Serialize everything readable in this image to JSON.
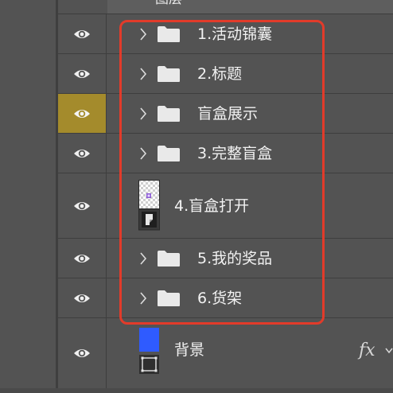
{
  "panel": {
    "header_label": "图层"
  },
  "layers": [
    {
      "name": "1.活动锦囊",
      "kind": "group",
      "selected": false
    },
    {
      "name": "2.标题",
      "kind": "group",
      "selected": false
    },
    {
      "name": "盲盒展示",
      "kind": "group",
      "selected": true
    },
    {
      "name": "3.完整盲盒",
      "kind": "group",
      "selected": false
    },
    {
      "name": "4.盲盒打开",
      "kind": "smart-object",
      "selected": false
    },
    {
      "name": "5.我的奖品",
      "kind": "group",
      "selected": false
    },
    {
      "name": "6.货架",
      "kind": "group",
      "selected": false
    },
    {
      "name": "背景",
      "kind": "shape",
      "selected": false,
      "effects_label": "fx",
      "thumb_color": "#2f5bff"
    }
  ],
  "colors": {
    "panel_bg": "#535353",
    "selected_eye_bg": "#a48b2c",
    "highlight_outline": "#e23b2a",
    "background_swatch": "#2f5bff"
  }
}
